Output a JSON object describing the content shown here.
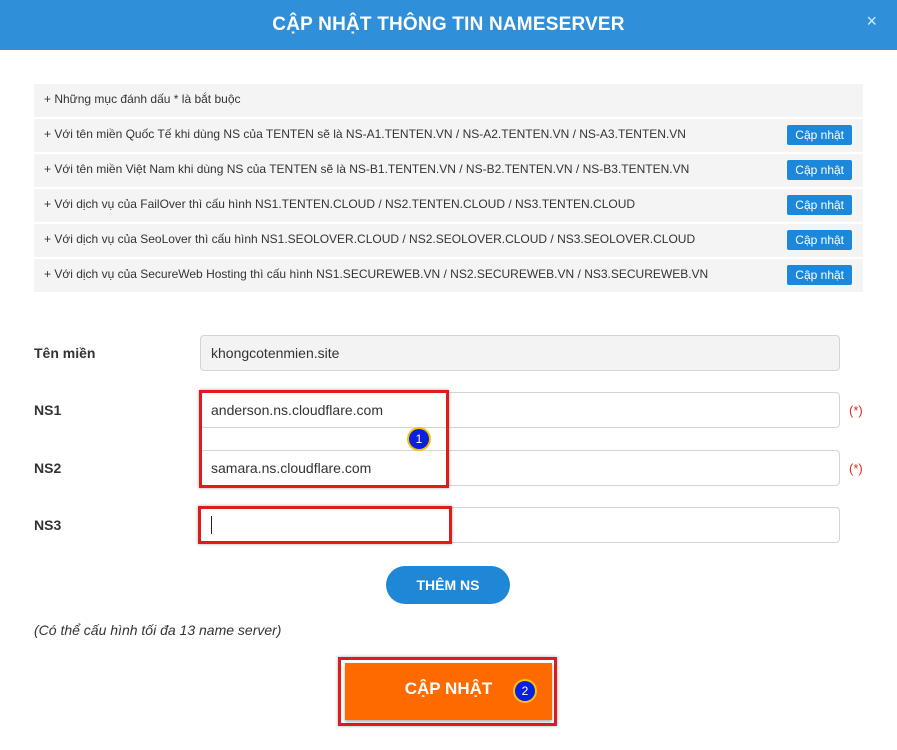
{
  "dialog": {
    "title": "CẬP NHẬT THÔNG TIN NAMESERVER",
    "close_glyph": "×"
  },
  "notes": [
    {
      "text": "+ Những mục đánh dấu * là bắt buộc",
      "button": ""
    },
    {
      "text": "+ Với tên miền Quốc Tế khi dùng NS của TENTEN sẽ là NS-A1.TENTEN.VN / NS-A2.TENTEN.VN / NS-A3.TENTEN.VN",
      "button": "Cập nhật"
    },
    {
      "text": "+ Với tên miền Việt Nam khi dùng NS của TENTEN sẽ là NS-B1.TENTEN.VN / NS-B2.TENTEN.VN / NS-B3.TENTEN.VN",
      "button": "Cập nhật"
    },
    {
      "text": "+ Với dịch vụ của FailOver thì cấu hình NS1.TENTEN.CLOUD / NS2.TENTEN.CLOUD / NS3.TENTEN.CLOUD",
      "button": "Cập nhật"
    },
    {
      "text": "+ Với dịch vụ của SeoLover thì cấu hình NS1.SEOLOVER.CLOUD / NS2.SEOLOVER.CLOUD / NS3.SEOLOVER.CLOUD",
      "button": "Cập nhật"
    },
    {
      "text": "+ Với dịch vụ của SecureWeb Hosting thì cấu hình NS1.SECUREWEB.VN / NS2.SECUREWEB.VN / NS3.SECUREWEB.VN",
      "button": "Cập nhật"
    }
  ],
  "form": {
    "domain_label": "Tên miền",
    "domain_value": "khongcotenmien.site",
    "ns1_label": "NS1",
    "ns1_value": "anderson.ns.cloudflare.com",
    "ns2_label": "NS2",
    "ns2_value": "samara.ns.cloudflare.com",
    "ns3_label": "NS3",
    "ns3_value": "",
    "required_mark": "(*)"
  },
  "add_ns_label": "THÊM NS",
  "hint": "(Có thể cấu hình tối đa 13 name server)",
  "submit_label": "CẬP NHẬT",
  "annotations": {
    "badge1": "1",
    "badge2": "2"
  },
  "colors": {
    "header": "#2f8fd8",
    "accent_button": "#1e87d6",
    "submit": "#ff6a00",
    "highlight": "#e01b1b",
    "required": "#e02b2b"
  }
}
